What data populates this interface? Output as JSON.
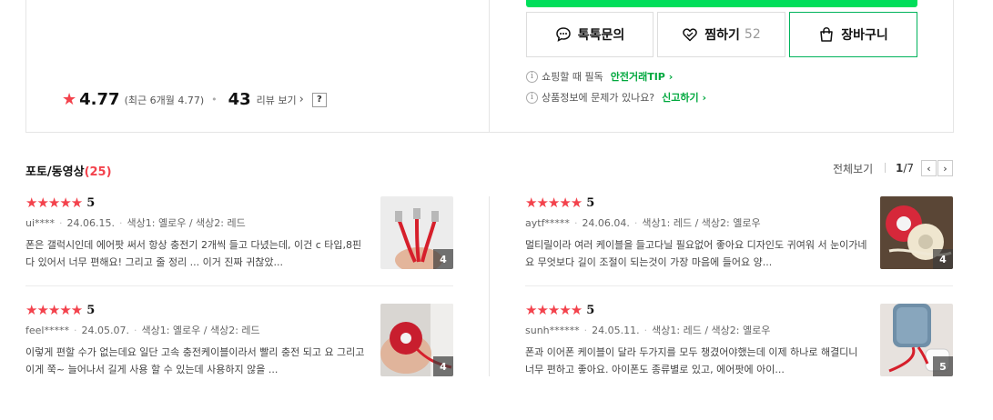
{
  "buttons": {
    "talk_label": "톡톡문의",
    "zzim_label": "찜하기",
    "zzim_count": "52",
    "cart_label": "장바구니"
  },
  "rating": {
    "star": "★",
    "value": "4.77",
    "recent": "(최근 6개월 4.77)",
    "dot": "•",
    "review_count": "43",
    "review_link": "리뷰 보기",
    "help": "?"
  },
  "info": {
    "line1_text": "쇼핑할 때 필독",
    "line1_link": "안전거래TIP",
    "line2_text": "상품정보에 문제가 있나요?",
    "line2_link": "신고하기"
  },
  "section": {
    "title": "포토/동영상",
    "count": "(25)",
    "see_all": "전체보기",
    "page_current": "1",
    "page_total": "/7"
  },
  "colors": {
    "accent_red": "#f3424c",
    "naver_green": "#00de5a",
    "link_green": "#00a83e"
  },
  "reviews": [
    {
      "stars": "★★★★★",
      "score": "5",
      "user": "ui****",
      "date": "24.06.15.",
      "options": "색상1: 옐로우 / 색상2: 레드",
      "text": "폰은 갤럭시인데 에어팟 써서 항상 충전기 2개씩 들고 다녔는데, 이건 c 타입,8핀 다 있어서 너무 편해요! 그리고 줄 정리 ... 이거 진짜 귀찮았...",
      "photo_count": "4"
    },
    {
      "stars": "★★★★★",
      "score": "5",
      "user": "aytf*****",
      "date": "24.06.04.",
      "options": "색상1: 레드 / 색상2: 옐로우",
      "text": "멀티릴이라 여러 케이블을 들고다닐 필요없어 좋아요 디자인도 귀여워 서 눈이가네요 무엇보다 길이 조절이 되는것이 가장 마음에 들어요 양...",
      "photo_count": "4"
    },
    {
      "stars": "★★★★★",
      "score": "5",
      "user": "feel*****",
      "date": "24.05.07.",
      "options": "색상1: 옐로우 / 색상2: 레드",
      "text": "이렇게 편할 수가 없는데요 일단 고속 충전케이블이라서 빨리 충전 되고 요 그리고 이게 쭉~ 늘어나서 길게 사용 할 수 있는데 사용하지 않을 ...",
      "photo_count": "4"
    },
    {
      "stars": "★★★★★",
      "score": "5",
      "user": "sunh******",
      "date": "24.05.11.",
      "options": "색상1: 레드 / 색상2: 옐로우",
      "text": "폰과 이어폰 케이블이 달라 두가지를 모두 챙겼어야했는데 이제 하나로 해결디니 너무 편하고 좋아요. 아이폰도 종류별로 있고, 에어팟에 아이...",
      "photo_count": "5"
    }
  ]
}
